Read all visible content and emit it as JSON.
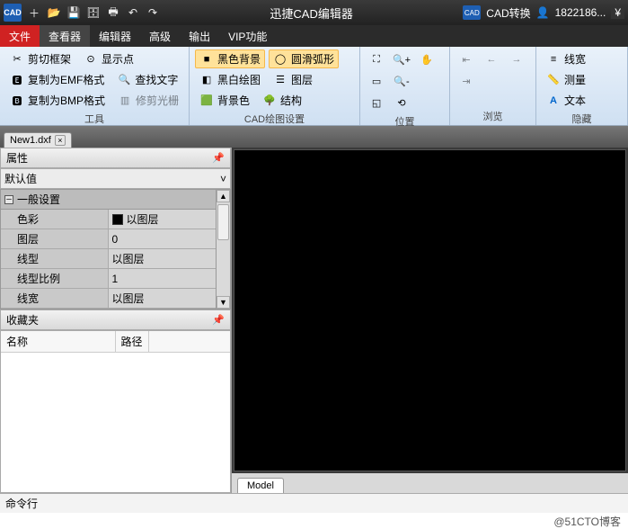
{
  "app": {
    "title": "迅捷CAD编辑器",
    "logo_text": "CAD",
    "cad_convert": "CAD转换",
    "user_id": "1822186...",
    "currency": "¥"
  },
  "qat_icons": [
    "plus-icon",
    "folder-open-icon",
    "save-icon",
    "save-all-icon",
    "print-icon",
    "undo-icon",
    "redo-icon"
  ],
  "menu": {
    "tabs": [
      "文件",
      "查看器",
      "编辑器",
      "高级",
      "输出",
      "VIP功能"
    ],
    "active_index": 1
  },
  "ribbon": {
    "groups": [
      {
        "name": "tools",
        "label": "工具",
        "items": [
          {
            "icon": "crop-icon",
            "label": "剪切框架"
          },
          {
            "icon": "emf-icon",
            "label": "复制为EMF格式"
          },
          {
            "icon": "bmp-icon",
            "label": "复制为BMP格式"
          },
          {
            "icon": "point-icon",
            "label": "显示点"
          },
          {
            "icon": "find-icon",
            "label": "查找文字"
          },
          {
            "icon": "trim-icon",
            "label": "修剪光栅",
            "disabled": true
          }
        ]
      },
      {
        "name": "cad-draw-settings",
        "label": "CAD绘图设置",
        "items": [
          {
            "icon": "bg-black-icon",
            "label": "黑色背景",
            "selected": true
          },
          {
            "icon": "bw-icon",
            "label": "黑白绘图"
          },
          {
            "icon": "bgcolor-icon",
            "label": "背景色"
          },
          {
            "icon": "smooth-arc-icon",
            "label": "圆滑弧形",
            "selected": true
          },
          {
            "icon": "layers-icon",
            "label": "图层"
          },
          {
            "icon": "structure-icon",
            "label": "结构"
          }
        ]
      },
      {
        "name": "position",
        "label": "位置",
        "items": [
          {
            "icon": "fit-icon"
          },
          {
            "icon": "zoom-in-icon"
          },
          {
            "icon": "pan-icon"
          },
          {
            "icon": "zoom-rect-icon"
          },
          {
            "icon": "zoom-out-icon"
          },
          {
            "icon": "zoom-sel-icon"
          },
          {
            "icon": "zoom-reset-icon"
          }
        ]
      },
      {
        "name": "browse",
        "label": "浏览",
        "items": [
          {
            "icon": "nav-first-icon",
            "disabled": true
          },
          {
            "icon": "nav-prev-icon",
            "disabled": true
          },
          {
            "icon": "nav-next-icon",
            "disabled": true
          },
          {
            "icon": "nav-last-icon",
            "disabled": true
          }
        ]
      },
      {
        "name": "hide",
        "label": "隐藏",
        "items": [
          {
            "icon": "lineweight-icon",
            "label": "线宽"
          },
          {
            "icon": "measure-icon",
            "label": "测量"
          },
          {
            "icon": "text-style-icon",
            "label": "文本"
          }
        ]
      }
    ]
  },
  "document": {
    "tab_name": "New1.dxf"
  },
  "panels": {
    "properties": {
      "title": "属性",
      "combo_value": "默认值",
      "section": "一般设置",
      "rows": [
        {
          "k": "色彩",
          "v": "以图层",
          "swatch": true
        },
        {
          "k": "图层",
          "v": "0"
        },
        {
          "k": "线型",
          "v": "以图层"
        },
        {
          "k": "线型比例",
          "v": "1"
        },
        {
          "k": "线宽",
          "v": "以图层"
        }
      ]
    },
    "favorites": {
      "title": "收藏夹",
      "columns": [
        "名称",
        "路径"
      ]
    }
  },
  "canvas": {
    "model_tab": "Model"
  },
  "command": {
    "label": "命令行"
  },
  "footer": {
    "watermark": "@51CTO博客"
  }
}
